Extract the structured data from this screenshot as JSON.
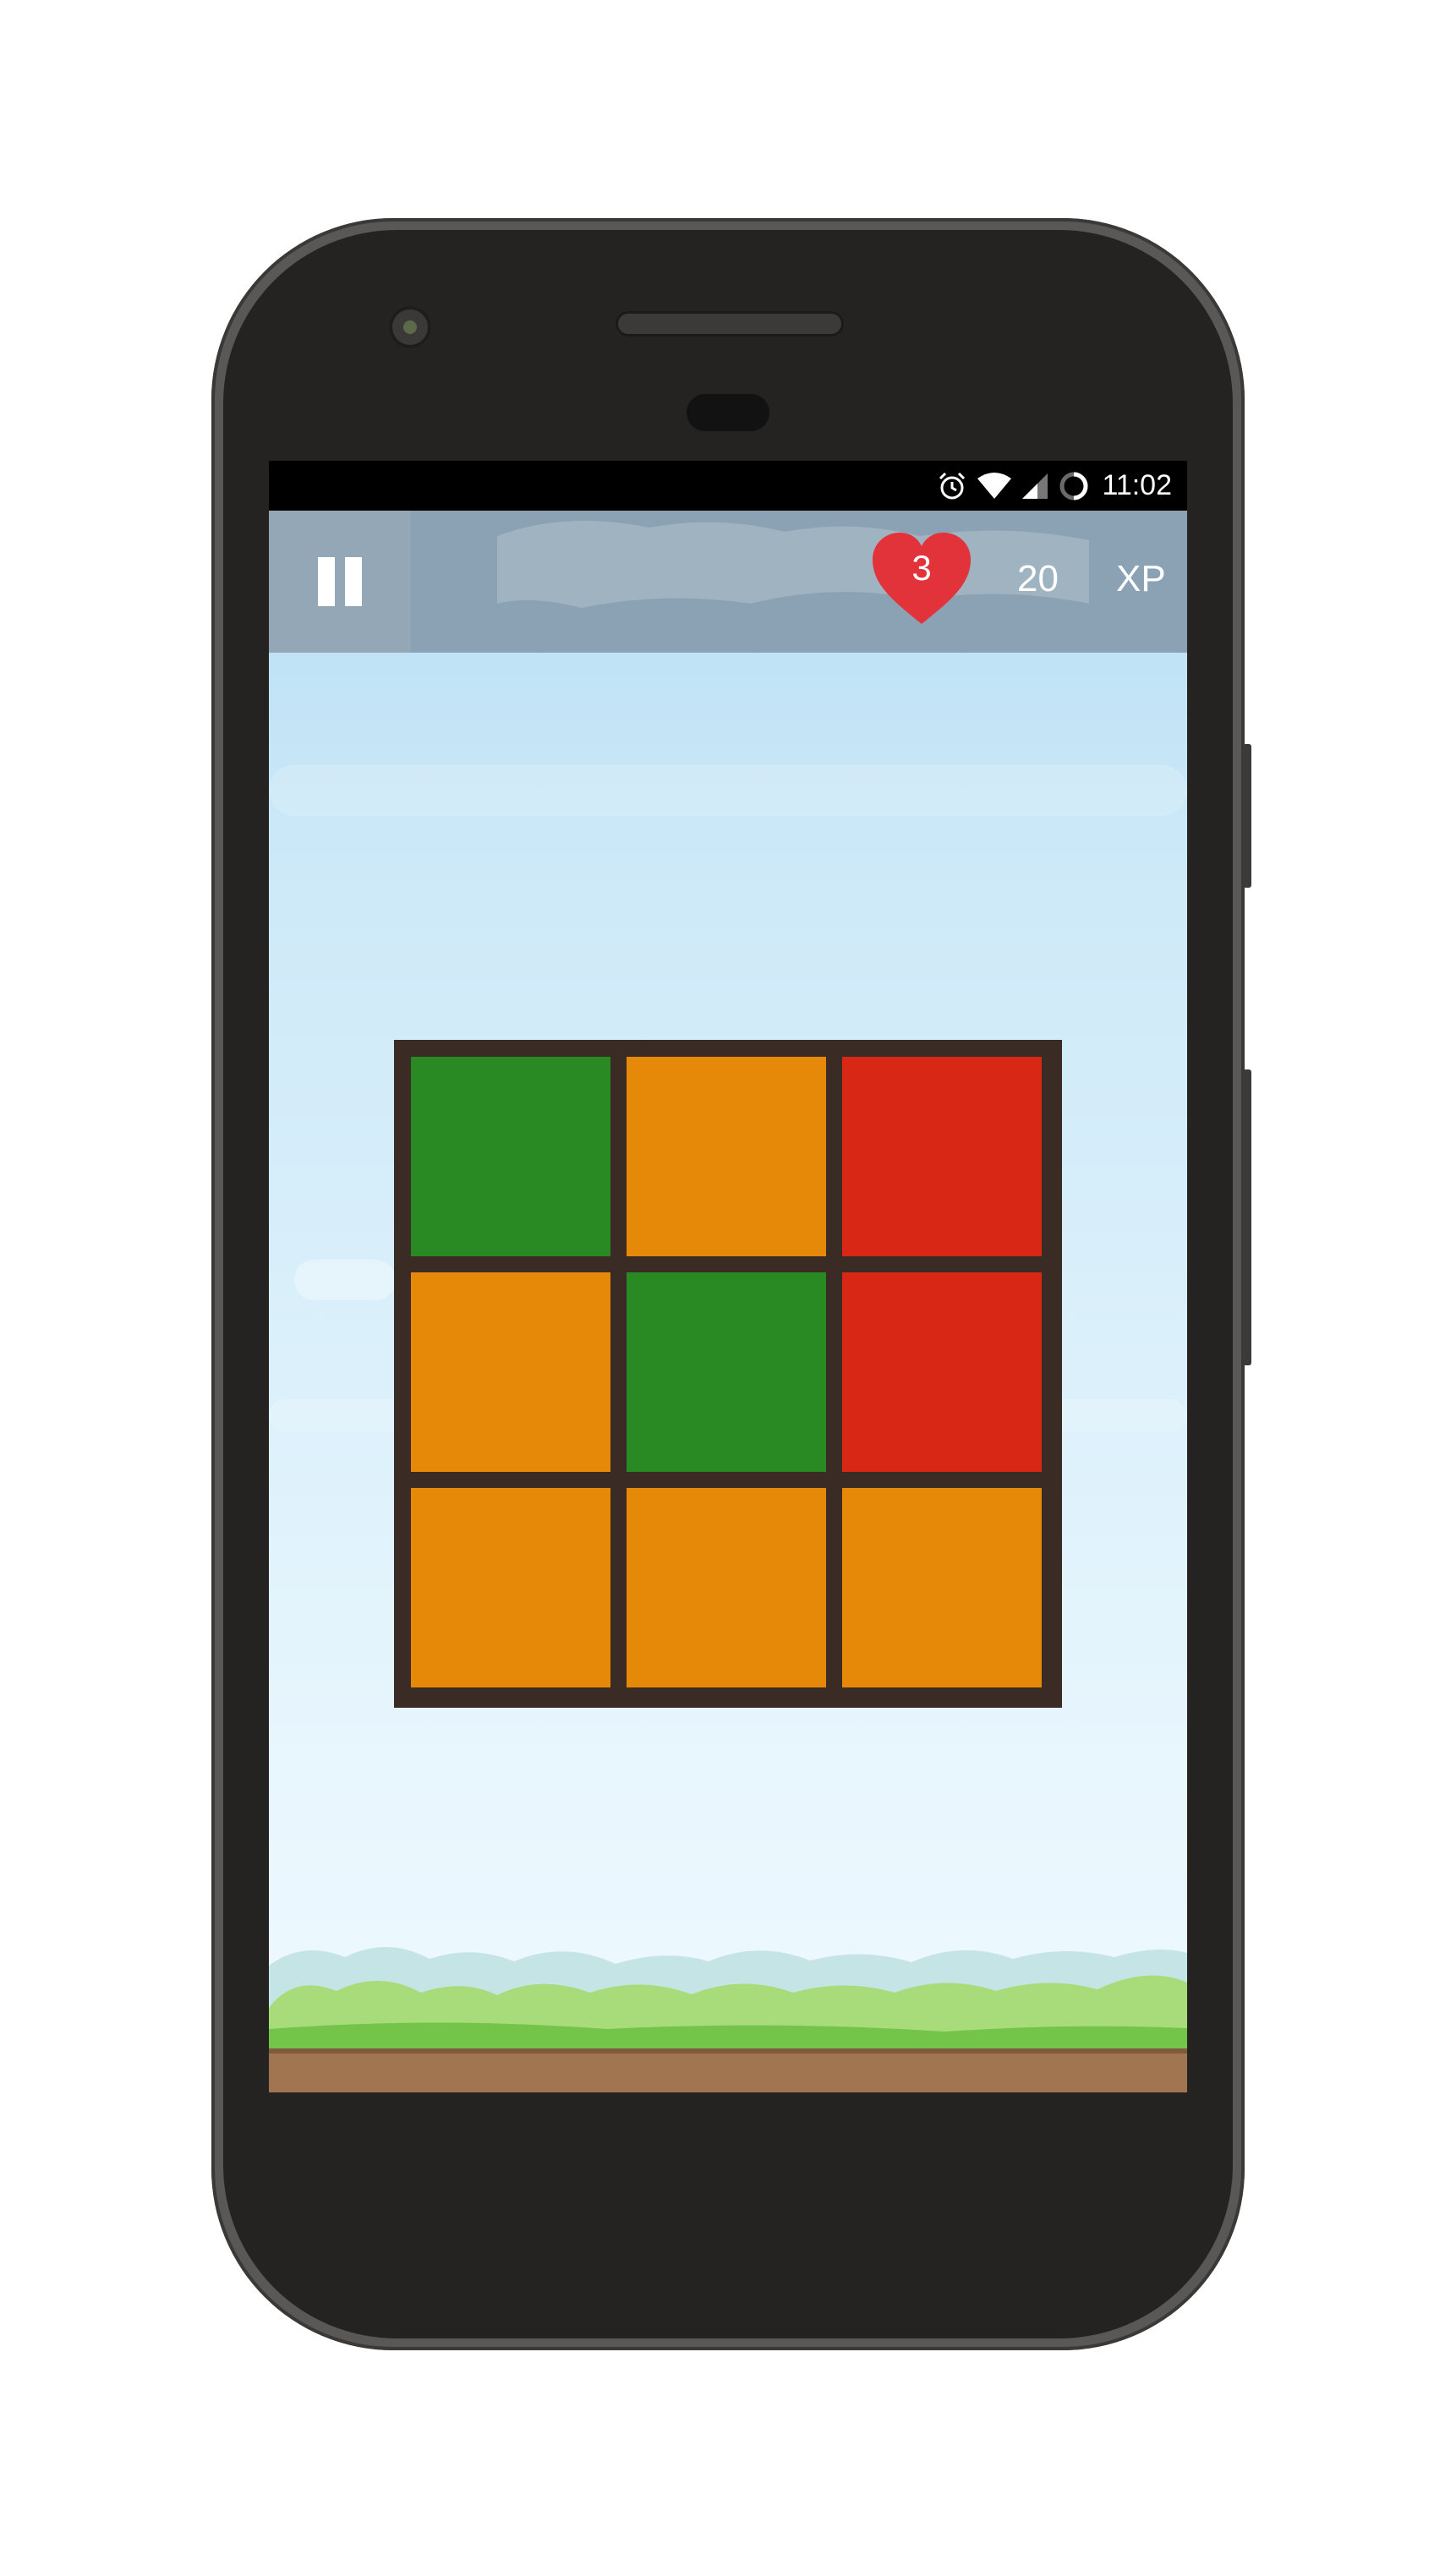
{
  "status_bar": {
    "time": "11:02",
    "icons": [
      "alarm-icon",
      "wifi-icon",
      "signal-icon",
      "battery-charging-icon"
    ]
  },
  "hud": {
    "pause_icon": "pause-icon",
    "lives": "3",
    "xp_value": "20",
    "xp_label": "XP",
    "heart_color": "#e2323a"
  },
  "board": {
    "rows": 3,
    "cols": 3,
    "tiles": [
      {
        "color": "#298a24",
        "name": "green"
      },
      {
        "color": "#e68908",
        "name": "orange"
      },
      {
        "color": "#d92716",
        "name": "red"
      },
      {
        "color": "#e68908",
        "name": "orange"
      },
      {
        "color": "#298a24",
        "name": "green"
      },
      {
        "color": "#d92716",
        "name": "red"
      },
      {
        "color": "#e68908",
        "name": "orange"
      },
      {
        "color": "#e68908",
        "name": "orange"
      },
      {
        "color": "#e68908",
        "name": "orange"
      }
    ],
    "border_color": "#3a2b24"
  }
}
